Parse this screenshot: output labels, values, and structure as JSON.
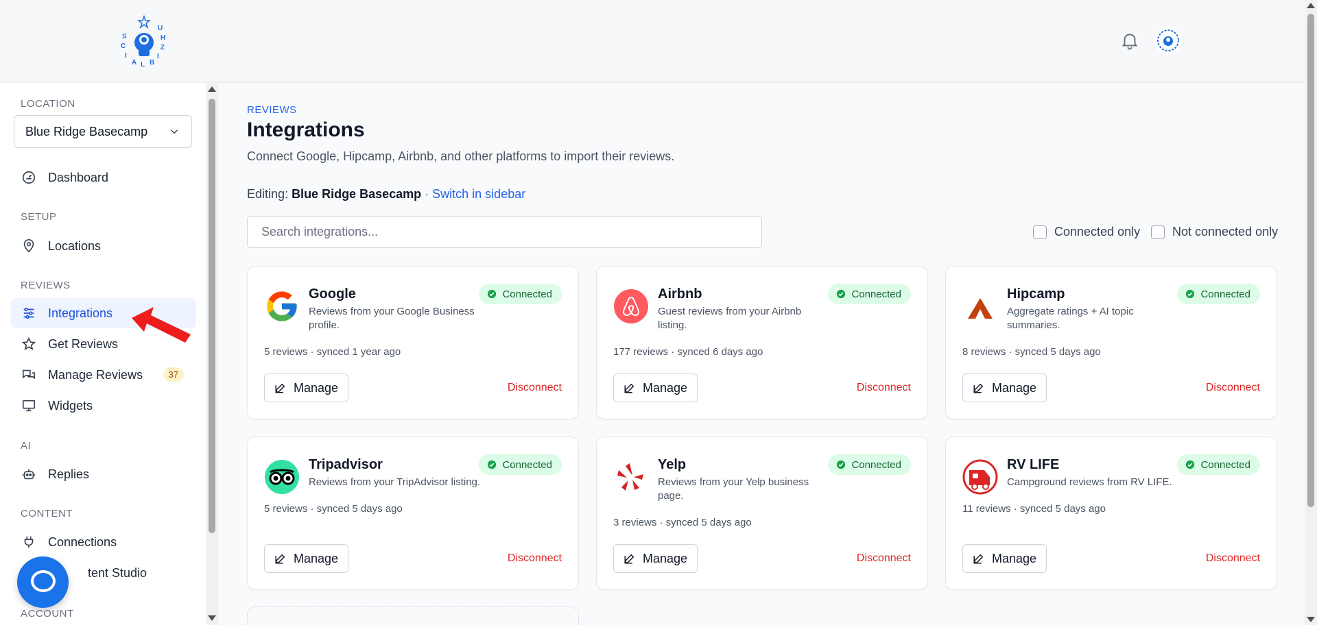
{
  "header": {
    "logo_text": "SOCIALBIZ HUB",
    "logo_icon": "astronaut-logo",
    "bell_icon": "bell-icon",
    "avatar_icon": "avatar-logo"
  },
  "sidebar": {
    "location_label": "LOCATION",
    "location_selected": "Blue Ridge Basecamp",
    "sections": {
      "setup": "SETUP",
      "reviews": "REVIEWS",
      "ai": "AI",
      "content": "CONTENT",
      "account": "ACCOUNT"
    },
    "items": {
      "dashboard": "Dashboard",
      "locations": "Locations",
      "integrations": "Integrations",
      "get_reviews": "Get Reviews",
      "manage_reviews": "Manage Reviews",
      "manage_reviews_badge": "37",
      "widgets": "Widgets",
      "replies": "Replies",
      "connections": "Connections",
      "content_studio": "tent Studio"
    },
    "active_color": "#1d4ed8"
  },
  "main": {
    "breadcrumb": "REVIEWS",
    "title": "Integrations",
    "subtitle": "Connect Google, Hipcamp, Airbnb, and other platforms to import their reviews.",
    "editing_label": "Editing:",
    "editing_location": "Blue Ridge Basecamp",
    "editing_sep": "·",
    "switch_link": "Switch in sidebar",
    "search_placeholder": "Search integrations...",
    "filters": {
      "connected_only": "Connected only",
      "not_connected_only": "Not connected only"
    },
    "manage_label": "Manage",
    "disconnect_label": "Disconnect",
    "cards": [
      {
        "name": "Google",
        "desc": "Reviews from your Google Business profile.",
        "status": "Connected",
        "meta": "5 reviews · synced 1 year ago",
        "icon": "google-icon"
      },
      {
        "name": "Airbnb",
        "desc": "Guest reviews from your Airbnb listing.",
        "status": "Connected",
        "meta": "177 reviews · synced 6 days ago",
        "icon": "airbnb-icon"
      },
      {
        "name": "Hipcamp",
        "desc": "Aggregate ratings + AI topic summaries.",
        "status": "Connected",
        "meta": "8 reviews · synced 5 days ago",
        "icon": "hipcamp-icon"
      },
      {
        "name": "Tripadvisor",
        "desc": "Reviews from your TripAdvisor listing.",
        "status": "Connected",
        "meta": "5 reviews · synced 5 days ago",
        "icon": "tripadvisor-icon"
      },
      {
        "name": "Yelp",
        "desc": "Reviews from your Yelp business page.",
        "status": "Connected",
        "meta": "3 reviews · synced 5 days ago",
        "icon": "yelp-icon"
      },
      {
        "name": "RV LIFE",
        "desc": "Campground reviews from RV LIFE.",
        "status": "Connected",
        "meta": "11 reviews · synced 5 days ago",
        "icon": "rvlife-icon"
      }
    ],
    "colors": {
      "accent": "#2563eb",
      "connected_bg": "#dcfce7",
      "connected_text": "#166534",
      "danger": "#dc2626"
    }
  }
}
